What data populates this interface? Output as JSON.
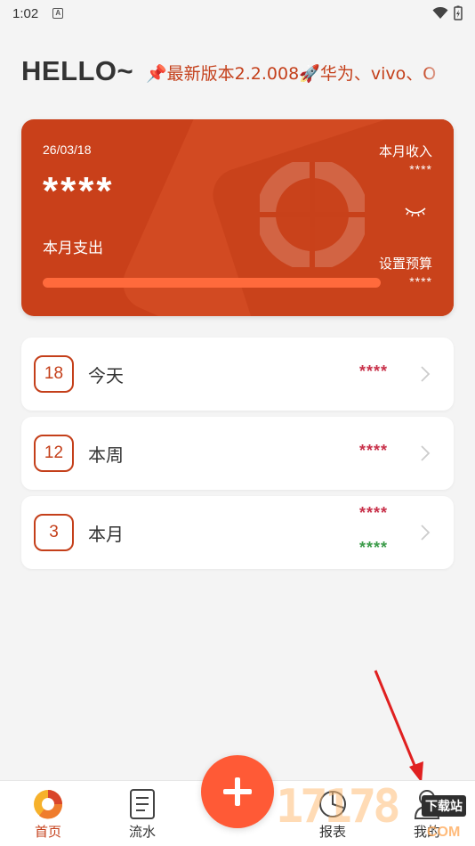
{
  "status": {
    "time": "1:02"
  },
  "header": {
    "greeting": "HELLO~",
    "marquee": "📌最新版本2.2.008🚀华为、vivo、O"
  },
  "card": {
    "date": "26/03/18",
    "expense_amount": "****",
    "expense_label": "本月支出",
    "income_label": "本月收入",
    "income_value": "****",
    "budget_label": "设置预算",
    "budget_value": "****",
    "budget_progress_percent": 100
  },
  "summary_rows": [
    {
      "day": "18",
      "label": "今天",
      "expense": "****"
    },
    {
      "day": "12",
      "label": "本周",
      "expense": "****"
    },
    {
      "day": "3",
      "label": "本月",
      "expense": "****",
      "income": "****"
    }
  ],
  "bottom_nav": {
    "tabs": [
      {
        "label": "首页"
      },
      {
        "label": "流水"
      },
      {
        "label": "报表"
      },
      {
        "label": "我的"
      }
    ]
  },
  "watermark": {
    "digits": "17178",
    "tag": "下载站",
    "suffix": "COM"
  },
  "colors": {
    "accent": "#c43f1a",
    "fab": "#ff5a36",
    "expense": "#c8314a",
    "income": "#3c9c4a"
  }
}
